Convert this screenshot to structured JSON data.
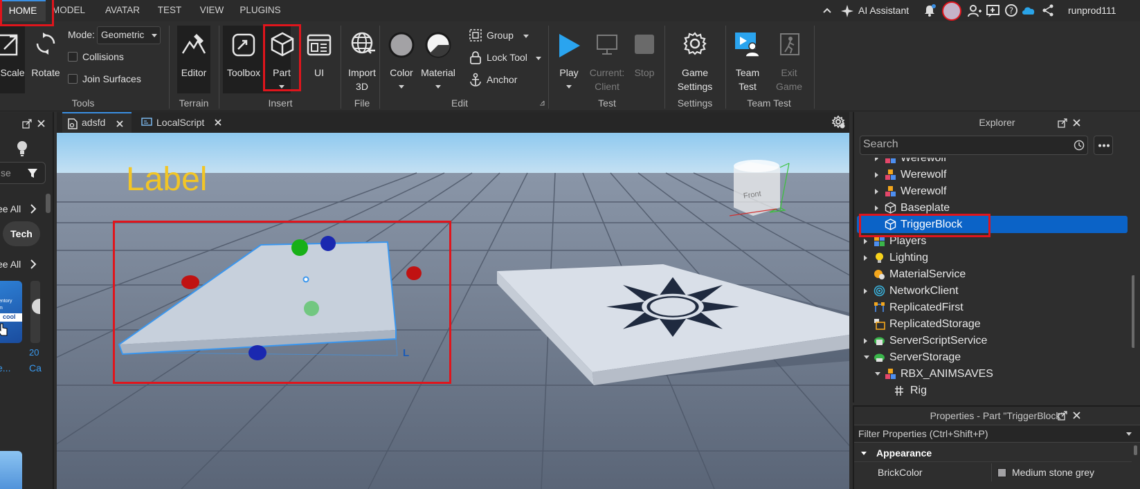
{
  "menubar": {
    "tabs": [
      {
        "label": "HOME",
        "active": true
      },
      {
        "label": "MODEL"
      },
      {
        "label": "AVATAR"
      },
      {
        "label": "TEST"
      },
      {
        "label": "VIEW"
      },
      {
        "label": "PLUGINS"
      }
    ],
    "ai_assistant": "AI Assistant",
    "username": "runprod111"
  },
  "ribbon": {
    "tools": {
      "scale": "Scale",
      "rotate": "Rotate",
      "mode_label": "Mode:",
      "mode_value": "Geometric",
      "collisions": "Collisions",
      "join_surfaces": "Join Surfaces",
      "group_label": "Tools"
    },
    "terrain": {
      "editor": "Editor",
      "group_label": "Terrain"
    },
    "insert": {
      "toolbox": "Toolbox",
      "part": "Part",
      "ui": "UI",
      "group_label": "Insert"
    },
    "file": {
      "import_line1": "Import",
      "import_line2": "3D",
      "group_label": "File"
    },
    "edit": {
      "color": "Color",
      "material": "Material",
      "group": "Group",
      "lock_tool": "Lock Tool",
      "anchor": "Anchor",
      "group_label": "Edit"
    },
    "test": {
      "play": "Play",
      "current_line1": "Current:",
      "current_line2": "Client",
      "stop": "Stop",
      "group_label": "Test"
    },
    "settings": {
      "line1": "Game",
      "line2": "Settings",
      "group_label": "Settings"
    },
    "team_test": {
      "team_line1": "Team",
      "team_line2": "Test",
      "exit_line1": "Exit",
      "exit_line2": "Game",
      "group_label": "Team Test"
    }
  },
  "left_panel": {
    "search_placeholder": "se",
    "see_all_1": "ee All",
    "chip": "Tech",
    "see_all_2": "ee All",
    "item_num": "20",
    "item_text1": "e...",
    "item_text2": "Ca",
    "thumb_text1": "entory",
    "thumb_text2": "m",
    "thumb_text3": "cool"
  },
  "doc_tabs": [
    {
      "label": "adsfd",
      "active": true
    },
    {
      "label": "LocalScript"
    }
  ],
  "viewport": {
    "label_text": "Label",
    "gizmo_face": "Front",
    "local_indicator": "L"
  },
  "explorer": {
    "title": "Explorer",
    "search_placeholder": "Search",
    "items": [
      {
        "label": "Werewolf",
        "icon": "model-icon"
      },
      {
        "label": "Werewolf",
        "icon": "model-icon"
      },
      {
        "label": "Werewolf",
        "icon": "model-icon"
      },
      {
        "label": "Baseplate",
        "icon": "part-icon"
      },
      {
        "label": "TriggerBlock",
        "icon": "part-icon",
        "selected": true
      },
      {
        "label": "Players",
        "icon": "players-icon"
      },
      {
        "label": "Lighting",
        "icon": "lighting-icon"
      },
      {
        "label": "MaterialService",
        "icon": "material-service-icon"
      },
      {
        "label": "NetworkClient",
        "icon": "network-client-icon"
      },
      {
        "label": "ReplicatedFirst",
        "icon": "replicated-first-icon"
      },
      {
        "label": "ReplicatedStorage",
        "icon": "replicated-storage-icon"
      },
      {
        "label": "ServerScriptService",
        "icon": "server-script-service-icon"
      },
      {
        "label": "ServerStorage",
        "icon": "server-storage-icon"
      },
      {
        "label": "RBX_ANIMSAVES",
        "icon": "model-icon"
      },
      {
        "label": "Rig",
        "icon": "rig-icon"
      }
    ]
  },
  "properties": {
    "title": "Properties - Part \"TriggerBlock\"",
    "filter_placeholder": "Filter Properties (Ctrl+Shift+P)",
    "section": "Appearance",
    "rows": [
      {
        "name": "BrickColor",
        "value": "Medium stone grey",
        "swatch": "#a3a2a5"
      }
    ]
  },
  "colors": {
    "accent": "#3a8fe3",
    "selection": "#0b63c7",
    "highlight": "#e0151c",
    "label_yellow": "#f2c526"
  }
}
